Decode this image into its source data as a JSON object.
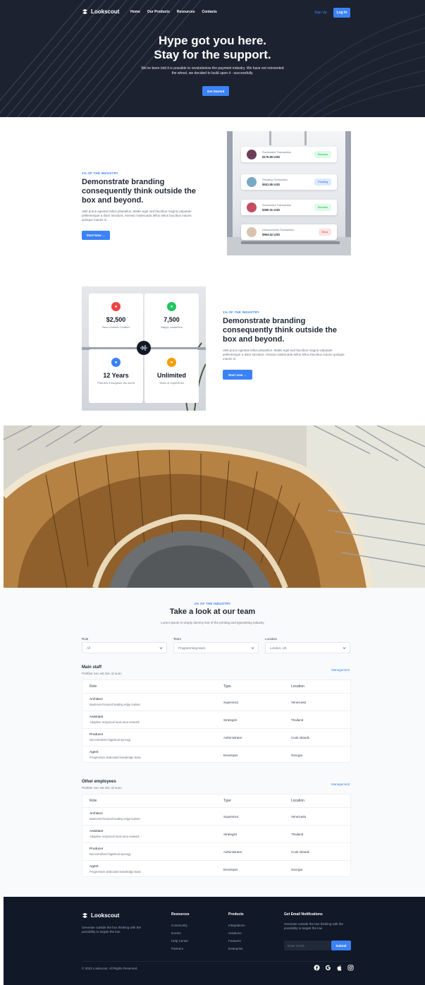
{
  "nav": {
    "brand": "Lookscout",
    "links": [
      "Home",
      "Our Products",
      "Resources",
      "Contacts"
    ],
    "signup": "Sign Up",
    "login": "Log In"
  },
  "hero": {
    "title_line1": "Hype got you here.",
    "title_line2": "Stay for the support.",
    "subtitle": "We've been told it is possible to revolutionize the payment industry. We have not reinvented the wheel, we decided to build upon it - successfully.",
    "cta": "Get Started"
  },
  "feature1": {
    "eyebrow": "1% OF THE INDUSTRY",
    "title": "Demonstrate branding consequently think outside the box and beyond.",
    "text": "Velit purus egestas tellus phasellus. Mattis eget sed faucibus magna vulputate pellentesque a diam tincidunt. Aenean malesuada tellus tellus faucibus mauris quisque mauris in.",
    "cta": "Start Now →",
    "transactions": [
      {
        "label": "Successful Transaction",
        "amount": "$175.55 USD",
        "status": "Success",
        "status_color": "#16a34a",
        "status_bg": "#dcfce7",
        "avatar_color": "#6b3f5a"
      },
      {
        "label": "Pending Transaction",
        "amount": "$531.85 USD",
        "status": "Pending",
        "status_color": "#2563eb",
        "status_bg": "#dbeafe",
        "avatar_color": "#7aa7c7"
      },
      {
        "label": "Successful Transaction",
        "amount": "$390.31 USD",
        "status": "Success",
        "status_color": "#16a34a",
        "status_bg": "#dcfce7",
        "avatar_color": "#c44d62"
      },
      {
        "label": "Unsuccessful Transaction",
        "amount": "$963.62 USD",
        "status": "Error",
        "status_color": "#dc2626",
        "status_bg": "#fee2e2",
        "avatar_color": "#d8c3b0"
      }
    ]
  },
  "feature2": {
    "eyebrow": "1% OF THE INDUSTRY",
    "title": "Demonstrate branding consequently think outside the box and beyond.",
    "text": "Velit purus egestas tellus phasellus. Mattis eget sed faucibus magna vulputate pellentesque a diam tincidunt. Aenean malesuada tellus tellus faucibus mauris quisque mauris in.",
    "cta": "Start now →",
    "stats": [
      {
        "value": "$2,500",
        "label": "New courses Created",
        "color": "#ef4444"
      },
      {
        "value": "7,500",
        "label": "Happy customers",
        "color": "#22c55e"
      },
      {
        "value": "12 Years",
        "label": "Partners throughout the world",
        "color": "#3b82f6"
      },
      {
        "value": "Unlimited",
        "label": "Years of experience",
        "color": "#f59e0b"
      }
    ]
  },
  "team": {
    "eyebrow": "1% OF THE INDUSTRY",
    "title": "Take a look at our team",
    "subtitle": "Lorem Ipsum is simply dummy text of the printing and typesetting industry",
    "filters": [
      {
        "label": "Role",
        "value": "All"
      },
      {
        "label": "Team",
        "value": "Programming team"
      },
      {
        "label": "Location",
        "value": "London, UK"
      }
    ],
    "groups": [
      {
        "title": "Main staff",
        "subtitle": "Porttitor nec est nisi, id nunc.",
        "link": "Management",
        "headers": [
          "Role",
          "Type",
          "Location"
        ],
        "rows": [
          {
            "role": "Architect",
            "desc": "Business-focused leading edge toolset",
            "type": "Supervisor",
            "location": "Venezuela"
          },
          {
            "role": "Assistant",
            "desc": "Adaptive reciprocal local area network",
            "type": "Strategist",
            "location": "Thailand"
          },
          {
            "role": "Producer",
            "desc": "Decentralized logistical synergy",
            "type": "Administrator",
            "location": "Cook Islands"
          },
          {
            "role": "Agent",
            "desc": "Progressive dedicated knowledge base",
            "type": "Developer",
            "location": "Georgia"
          }
        ]
      },
      {
        "title": "Other employees",
        "subtitle": "Porttitor nec est nisi, id nunc.",
        "link": "Management",
        "headers": [
          "Role",
          "Type",
          "Location"
        ],
        "rows": [
          {
            "role": "Architect",
            "desc": "Business-focused leading edge toolset",
            "type": "Supervisor",
            "location": "Venezuela"
          },
          {
            "role": "Assistant",
            "desc": "Adaptive reciprocal local area network",
            "type": "Strategist",
            "location": "Thailand"
          },
          {
            "role": "Producer",
            "desc": "Decentralized logistical synergy",
            "type": "Administrator",
            "location": "Cook Islands"
          },
          {
            "role": "Agent",
            "desc": "Progressive dedicated knowledge base",
            "type": "Developer",
            "location": "Georgia"
          }
        ]
      }
    ]
  },
  "footer": {
    "brand": "Lookscout",
    "description": "Generate outside the box thinking with the possibility to targtet the low.",
    "columns": [
      {
        "title": "Resources",
        "items": [
          "Community",
          "Events",
          "Help Center",
          "Partners"
        ]
      },
      {
        "title": "Products",
        "items": [
          "Integrations",
          "Solutions",
          "Features",
          "Enterprise"
        ]
      }
    ],
    "newsletter": {
      "title": "Get Email Notifications",
      "text": "Generate outside the box thinking with the possibility to targtet the low",
      "placeholder": "Enter email...",
      "submit": "Submit"
    },
    "copyright": "© 2023 Lookscout. All Rights Reserved.",
    "social": [
      "facebook-icon",
      "google-icon",
      "apple-icon",
      "instagram-icon"
    ]
  }
}
